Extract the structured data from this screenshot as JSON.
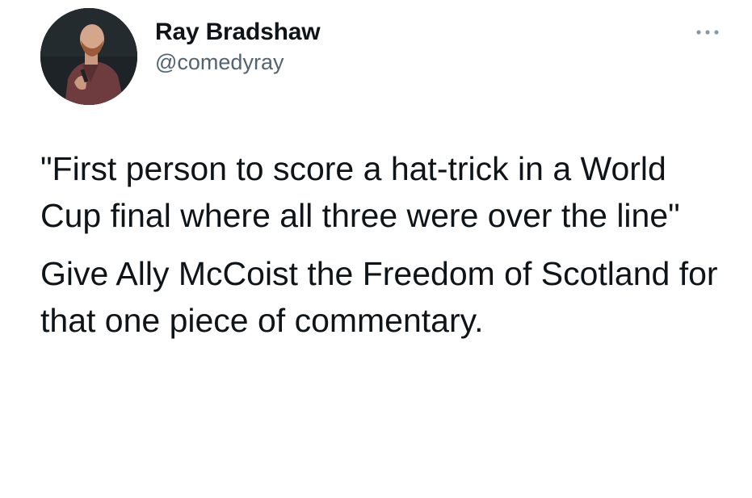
{
  "tweet": {
    "author": {
      "display_name": "Ray Bradshaw",
      "handle": "@comedyray",
      "avatar_icon": "profile-photo"
    },
    "more_icon": "more-horizontal-icon",
    "paragraphs": [
      "\"First person to score a hat-trick in a World Cup final where all three were over the line\"",
      "Give Ally McCoist the Freedom of Scotland for that one piece of commentary."
    ],
    "colors": {
      "text": "#0f1419",
      "secondary": "#536471",
      "background": "#ffffff"
    }
  }
}
